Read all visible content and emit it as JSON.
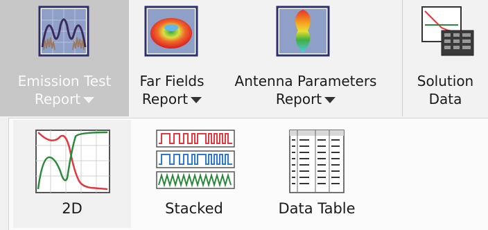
{
  "ribbon": {
    "buttons": [
      {
        "line1": "Emission Test",
        "line2": "Report",
        "icon": "emission-chart-icon",
        "dropdown": true,
        "active": true
      },
      {
        "line1": "Far Fields",
        "line2": "Report",
        "icon": "far-field-3d-icon",
        "dropdown": true
      },
      {
        "line1": "Antenna Parameters",
        "line2": "Report",
        "icon": "antenna-pattern-icon",
        "dropdown": true
      },
      {
        "line1": "Solution",
        "line2": "Data",
        "icon": "solution-data-icon",
        "dropdown": false
      }
    ]
  },
  "menu": {
    "items": [
      {
        "label": "2D",
        "icon": "2d-plot-icon"
      },
      {
        "label": "Stacked",
        "icon": "stacked-plot-icon"
      },
      {
        "label": "Data Table",
        "icon": "data-table-icon"
      }
    ]
  },
  "colors": {
    "active_button_bg": "#c7c7c7",
    "plot_red": "#e8363d",
    "plot_green": "#2a8a3a",
    "plot_blue": "#2a7ad2",
    "icon_navy": "#2c2f6b"
  }
}
